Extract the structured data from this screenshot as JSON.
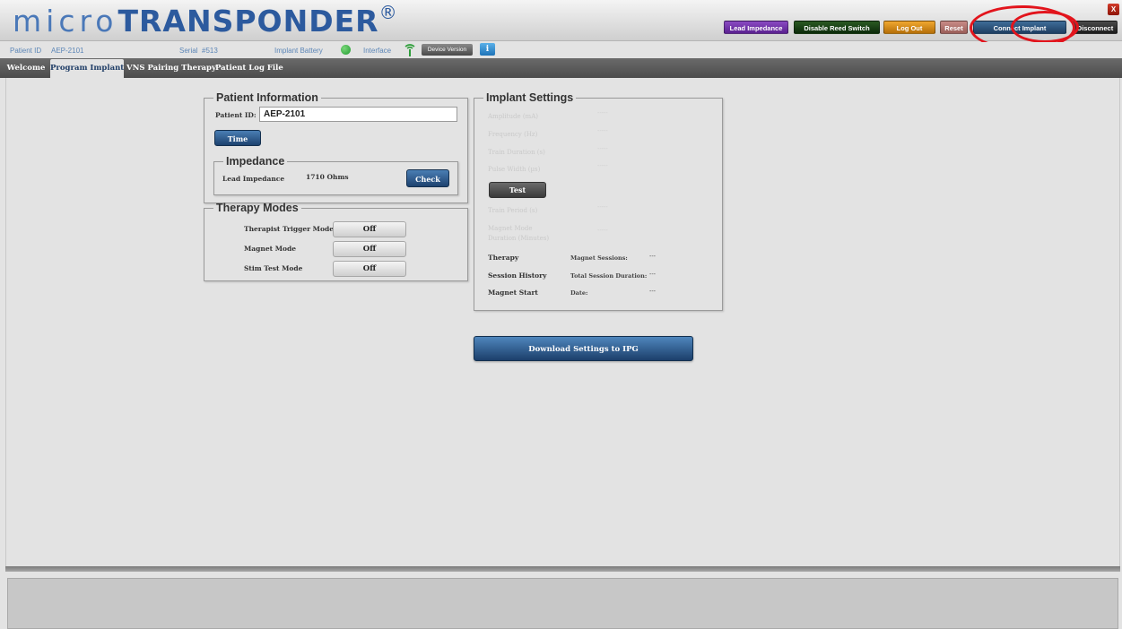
{
  "logo": {
    "micro": "micro",
    "transponder": "TRANSPONDER",
    "reg": "®"
  },
  "header_buttons": {
    "lead_impedance": "Lead Impedance",
    "disable_reed": "Disable Reed Switch",
    "log_out": "Log Out",
    "reset": "Reset",
    "connect_implant": "Connect Implant",
    "disconnect": "Disconnect",
    "close": "X"
  },
  "info_bar": {
    "patient_id_label": "Patient ID",
    "patient_id_value": "AEP-2101",
    "serial_label": "Serial",
    "serial_value": "#513",
    "battery_label": "Implant Battery",
    "interface_label": "Interface",
    "device_version": "Device Version",
    "info_icon": "i"
  },
  "tabs": [
    {
      "label": "Welcome"
    },
    {
      "label": "Program Implant"
    },
    {
      "label": "VNS Pairing Therapy"
    },
    {
      "label": "Patient Log File"
    }
  ],
  "patient_info": {
    "legend": "Patient Information",
    "id_label": "Patient ID:",
    "id_value": "AEP-2101",
    "time_button": "Time"
  },
  "impedance": {
    "legend": "Impedance",
    "label": "Lead Impedance",
    "value": "1710 Ohms",
    "check_button": "Check"
  },
  "therapy_modes": {
    "legend": "Therapy Modes",
    "rows": [
      {
        "label": "Therapist Trigger Mode",
        "state": "Off"
      },
      {
        "label": "Magnet Mode",
        "state": "Off"
      },
      {
        "label": "Stim Test Mode",
        "state": "Off"
      }
    ]
  },
  "implant_settings": {
    "legend": "Implant Settings",
    "disabled_fields": [
      {
        "label": "Amplitude (mA)",
        "value": "-----"
      },
      {
        "label": "Frequency (Hz)",
        "value": "-----"
      },
      {
        "label": "Train Duration (s)",
        "value": "-----"
      },
      {
        "label": "Pulse Width (µs)",
        "value": "-----"
      }
    ],
    "test_button": "Test",
    "disabled_fields_2": [
      {
        "label": "Train Period (s)",
        "value": "-----"
      },
      {
        "label": "Magnet Mode",
        "label2": "Duration (Minutes)",
        "value": "-----"
      }
    ],
    "history": [
      {
        "label": "Therapy",
        "sub": "Magnet Sessions:",
        "value": "---"
      },
      {
        "label": "Session History",
        "sub": "Total Session Duration:",
        "value": "---"
      },
      {
        "label": "Magnet Start",
        "sub": "Date:",
        "value": "---"
      }
    ]
  },
  "download_button": "Download Settings to IPG",
  "colors": {
    "accent_blue": "#2c5a9e",
    "lead_impedance": "#6a2fa5",
    "disable_reed": "#0f3a0c",
    "log_out": "#d48a16",
    "reset": "#b07570",
    "annotation_ring": "#e2141c"
  }
}
